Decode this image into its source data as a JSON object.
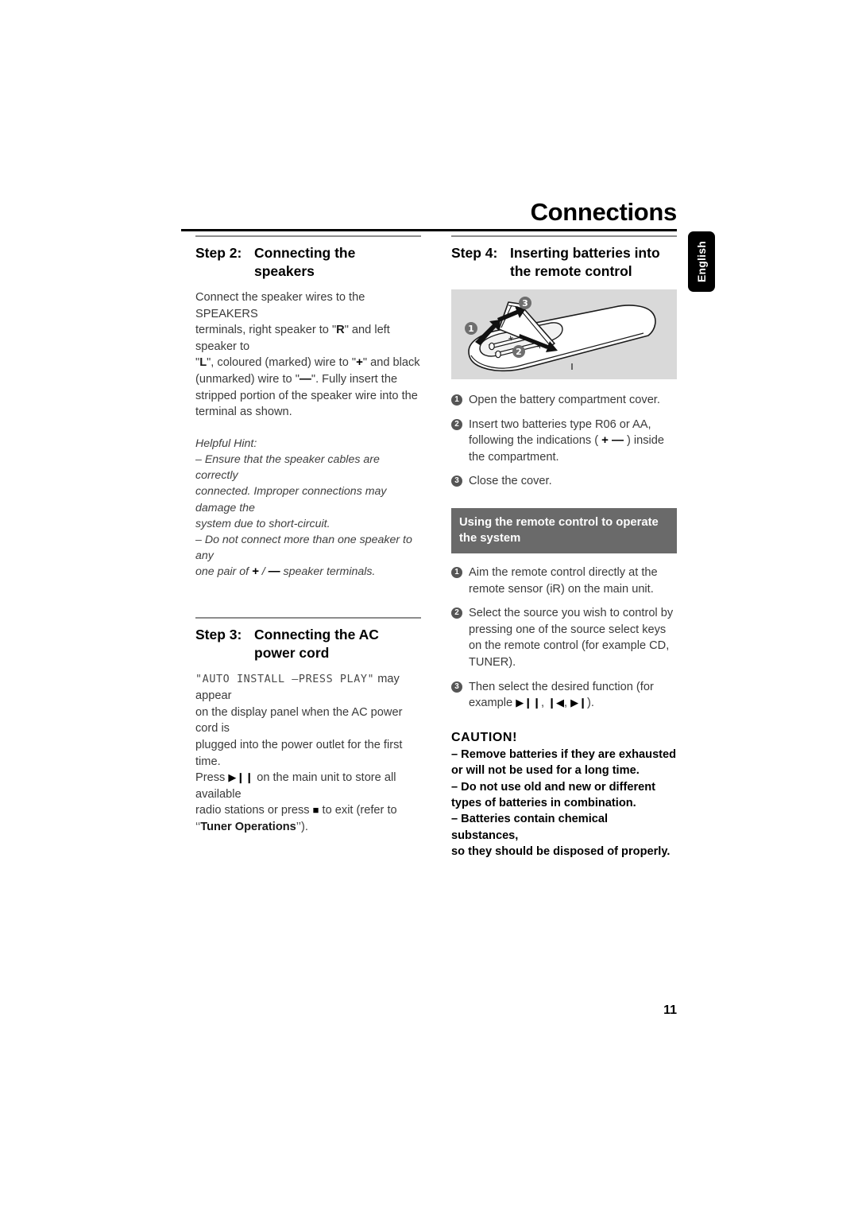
{
  "page": {
    "title": "Connections",
    "language_tab": "English",
    "page_number": "11"
  },
  "left_column": {
    "step2": {
      "number": "Step 2:",
      "title_line1": "Connecting the",
      "title_line2": "speakers",
      "body_line1": "Connect the speaker wires to the SPEAKERS",
      "body_line2_a": "terminals, right speaker to \"",
      "body_line2_b": "R",
      "body_line2_c": "\" and left speaker to",
      "body_line3_a": "\"",
      "body_line3_b": "L",
      "body_line3_c": "\", coloured (marked) wire to \"",
      "body_line3_d": "+",
      "body_line3_e": "\" and black",
      "body_line4_a": "(unmarked) wire to \"",
      "body_line4_b": "—",
      "body_line4_c": "\".  Fully insert the",
      "body_line5": "stripped portion of the speaker wire into the",
      "body_line6": "terminal as shown.",
      "hint_label": "Helpful Hint:",
      "hint_1_line1": "–  Ensure that the speaker cables are correctly",
      "hint_1_line2": "connected.  Improper connections may damage the",
      "hint_1_line3": "system due to short-circuit.",
      "hint_2_line1": "–  Do not connect more than one speaker to any",
      "hint_2_line2_a": "one pair of ",
      "hint_2_line2_b": "+",
      "hint_2_line2_c": " / ",
      "hint_2_line2_d": "—",
      "hint_2_line2_e": "  speaker terminals."
    },
    "step3": {
      "number": "Step 3:",
      "title_line1": "Connecting the AC",
      "title_line2": "power cord",
      "lcd_text": "\"AUTO INSTALL –PRESS PLAY\"",
      "body_line1_tail": " may appear",
      "body_line2": "on the display panel when the AC power cord is",
      "body_line3": "plugged into the power outlet for the first time.",
      "body_line4_a": "Press ",
      "body_line4_playpause": "▶❙❙",
      "body_line4_b": " on the main unit to store all available",
      "body_line5_a": "radio stations or press ",
      "body_line5_stop": "■",
      "body_line5_b": " to exit (refer to",
      "body_line6_a": "‘‘",
      "body_line6_b": "Tuner Operations",
      "body_line6_c": "’’)."
    }
  },
  "right_column": {
    "step4": {
      "number": "Step 4:",
      "title_line1": "Inserting batteries into",
      "title_line2": "the remote control"
    },
    "illustration": {
      "name": "remote-control-battery-compartment",
      "callouts": [
        "1",
        "2",
        "3"
      ],
      "battery_marks": [
        "+",
        "+"
      ],
      "background_color": "#d9d9d9"
    },
    "battery_steps": [
      {
        "num": "1",
        "text": "Open the battery compartment cover."
      },
      {
        "num": "2",
        "text_a": "Insert two batteries type R06 or AA, following the indications ( ",
        "text_plus": "+",
        "text_minus": "—",
        "text_b": " ) inside the compartment."
      },
      {
        "num": "3",
        "text": "Close the cover."
      }
    ],
    "gray_bar": {
      "line1": "Using the remote control to operate",
      "line2": "the system"
    },
    "remote_steps": [
      {
        "num": "1",
        "text": "Aim the remote control directly at the remote sensor (iR) on the main unit."
      },
      {
        "num": "2",
        "text": "Select the source you wish to control by pressing one of the source select keys on the remote control (for example CD, TUNER)."
      },
      {
        "num": "3",
        "text_a": "Then select the desired function (for example ",
        "glyph_play": "▶❙❙",
        "sep1": ", ",
        "glyph_prev": "❙◀",
        "sep2": ",  ",
        "glyph_next": "▶❙",
        "text_b": ")."
      }
    ],
    "caution": {
      "heading": "CAUTION!",
      "line1": "–  Remove batteries if they are exhausted",
      "line2": "or will not be used for a long time.",
      "line3": "–  Do not use old and new or different",
      "line4": "types of batteries in combination.",
      "line5": "–  Batteries contain chemical substances,",
      "line6": "so they should be disposed of properly."
    }
  },
  "colors": {
    "title_rule": "#000000",
    "section_rule": "#8d8d8d",
    "body_text": "#3a3a3a",
    "gray_bar": "#6a6a6a",
    "bullet_circle": "#555555",
    "lang_tab": "#000000"
  }
}
